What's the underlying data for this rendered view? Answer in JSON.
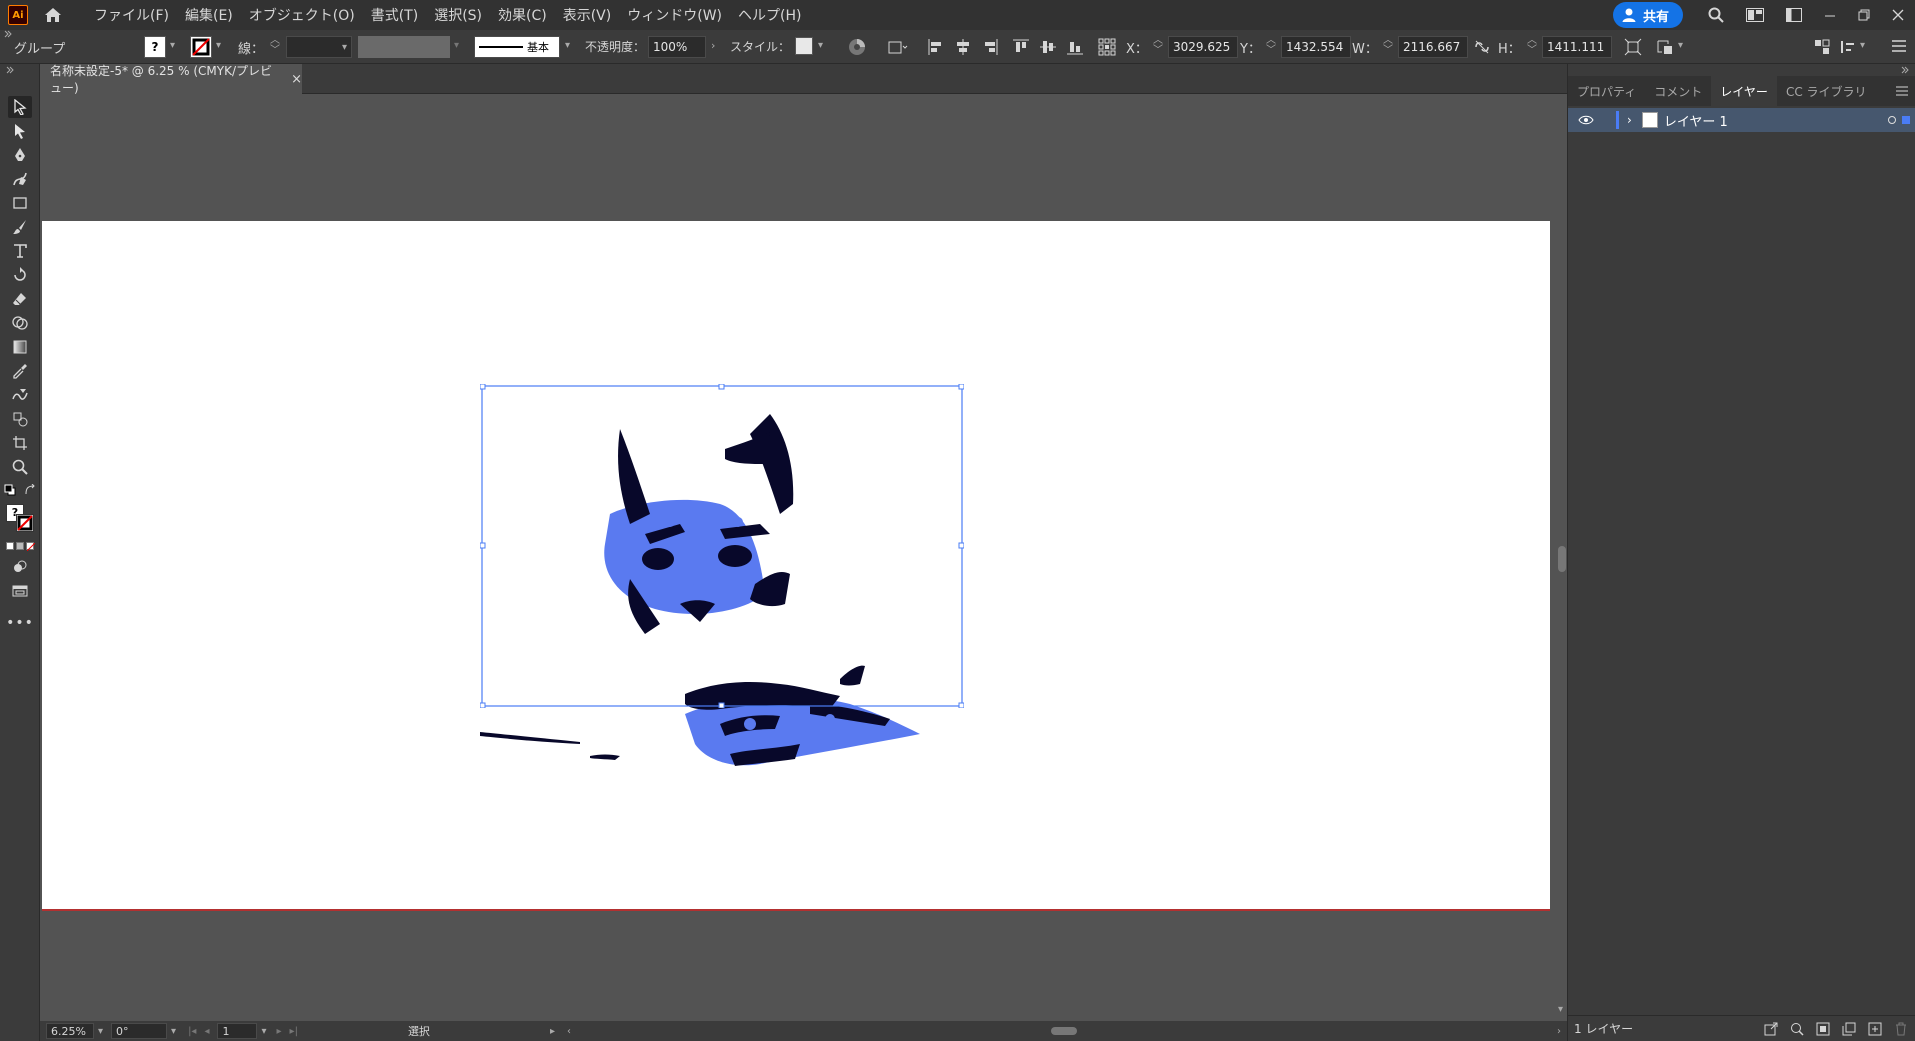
{
  "app": {
    "logo_text": "Ai"
  },
  "menu": {
    "items": [
      "ファイル(F)",
      "編集(E)",
      "オブジェクト(O)",
      "書式(T)",
      "選択(S)",
      "効果(C)",
      "表示(V)",
      "ウィンドウ(W)",
      "ヘルプ(H)"
    ],
    "share_label": "共有"
  },
  "control": {
    "object_type": "グループ",
    "stroke_label": "線：",
    "stroke_style_label": "基本",
    "opacity_label": "不透明度：",
    "opacity_value": "100%",
    "style_label": "スタイル：",
    "x_label": "X：",
    "x_value": "3029.625",
    "y_label": "Y：",
    "y_value": "1432.554",
    "w_label": "W：",
    "w_value": "2116.667",
    "h_label": "H：",
    "h_value": "1411.111"
  },
  "document": {
    "tab_title": "名称未設定-5* @ 6.25 % (CMYK/プレビュー)",
    "close_glyph": "×"
  },
  "status": {
    "zoom": "6.25%",
    "rotation": "0°",
    "artboard_number": "1",
    "tool_name": "選択"
  },
  "panel": {
    "tabs": [
      "プロパティ",
      "コメント",
      "レイヤー",
      "CC ライブラリ"
    ],
    "active_tab": 2,
    "layer_name": "レイヤー 1",
    "footer_count": "1 レイヤー"
  },
  "colors": {
    "selection": "#4a7cf5",
    "artwork_dark": "#08082a",
    "artwork_blue": "#5a7af0"
  }
}
